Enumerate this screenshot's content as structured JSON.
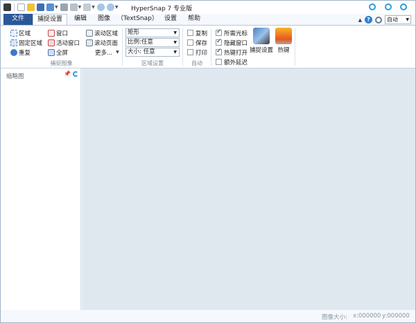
{
  "window": {
    "title": "HyperSnap 7 专业版"
  },
  "tabs": [
    {
      "label": "文件"
    },
    {
      "label": "捕捉设置"
    },
    {
      "label": "编辑"
    },
    {
      "label": "图像"
    },
    {
      "label": "（TextSnap）"
    },
    {
      "label": "设置"
    },
    {
      "label": "帮助"
    }
  ],
  "zoom": {
    "value": "自动"
  },
  "capture_image_group": {
    "label": "捕捉图像",
    "region": "区域",
    "fixed_region": "固定区域",
    "repeat": "重复",
    "window": "窗口",
    "active_window": "活动窗口",
    "fullscreen": "全屏",
    "scroll_region": "滚动区域",
    "scroll_page": "滚动页面",
    "more": "更多..."
  },
  "region_settings_group": {
    "label": "区域设置",
    "shape": "矩形",
    "ratio": "比例:任意",
    "size": "大小: 任意"
  },
  "auto_group": {
    "label": "自动",
    "copy": "复制",
    "save": "保存",
    "print": "打印"
  },
  "options_group": {
    "include_cursor": "所需光标",
    "hide_window": "隐藏窗口",
    "hotkey_open": "热键打开",
    "extra_delay": "额外延迟",
    "capture_settings": "捕捉设置",
    "hotkeys": "热键"
  },
  "thumbnail_pane": {
    "title": "缩略图"
  },
  "status": {
    "image_size": "图像大小:",
    "x": "x:000000",
    "y": "y:000000"
  }
}
